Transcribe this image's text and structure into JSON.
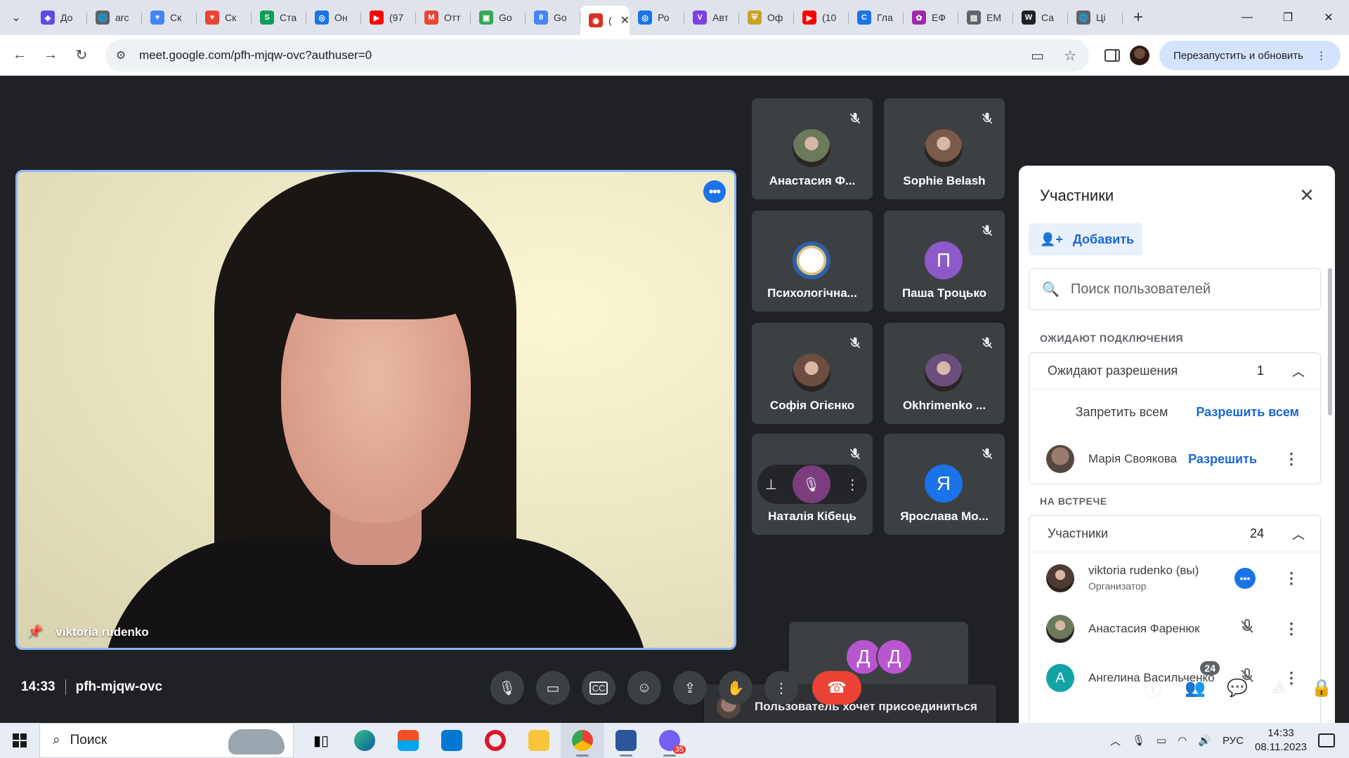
{
  "browser": {
    "tabs": [
      {
        "title": "До",
        "color": "#5b4de3",
        "glyph": "◈"
      },
      {
        "title": "arc",
        "color": "#5f6368",
        "glyph": "🌐"
      },
      {
        "title": "Ск",
        "color": "#4285f4",
        "glyph": "♥"
      },
      {
        "title": "Ск",
        "color": "#ea4335",
        "glyph": "♥"
      },
      {
        "title": "Ста",
        "color": "#0f9d58",
        "glyph": "S"
      },
      {
        "title": "Он",
        "color": "#1a73e8",
        "glyph": "◎"
      },
      {
        "title": "(97",
        "color": "#ff0000",
        "glyph": "▶"
      },
      {
        "title": "Отт",
        "color": "#ea4335",
        "glyph": "M"
      },
      {
        "title": "Go",
        "color": "#34a853",
        "glyph": "▣"
      },
      {
        "title": "Go",
        "color": "#4285f4",
        "glyph": "8"
      },
      {
        "title": "(",
        "color": "#d93025",
        "glyph": "◉",
        "active": true
      },
      {
        "title": "Ро",
        "color": "#1a73e8",
        "glyph": "◎"
      },
      {
        "title": "Авт",
        "color": "#7b3fe4",
        "glyph": "V"
      },
      {
        "title": "Оф",
        "color": "#c9a227",
        "glyph": "⛨"
      },
      {
        "title": "(10",
        "color": "#ff0000",
        "glyph": "▶"
      },
      {
        "title": "Гла",
        "color": "#1a73e8",
        "glyph": "C"
      },
      {
        "title": "ЕФ",
        "color": "#9c27b0",
        "glyph": "✿"
      },
      {
        "title": "ЕМ",
        "color": "#5f6368",
        "glyph": "▤"
      },
      {
        "title": "Са",
        "color": "#202124",
        "glyph": "W"
      },
      {
        "title": "Ці",
        "color": "#5f6368",
        "glyph": "🌐"
      }
    ],
    "url": "meet.google.com/pfh-mjqw-ovc?authuser=0",
    "relaunch_label": "Перезапустить и обновить"
  },
  "meet": {
    "main_speaker": "viktoria rudenko",
    "tiles": [
      {
        "name": "Анастасия Ф...",
        "avatar": "photo",
        "color": "#6b7a5a",
        "muted": true
      },
      {
        "name": "Sophie Belash",
        "avatar": "photo",
        "color": "#7a5a48",
        "muted": true
      },
      {
        "name": "Психологічна...",
        "avatar": "logo",
        "color": "#f1f3f4",
        "muted": false
      },
      {
        "name": "Паша Троцько",
        "avatar": "П",
        "color": "#8e59c9",
        "muted": true
      },
      {
        "name": "Софія Огієнко",
        "avatar": "photo",
        "color": "#6d4c41",
        "muted": true
      },
      {
        "name": "Okhrimenko ...",
        "avatar": "photo",
        "color": "#6a4f7c",
        "muted": true
      },
      {
        "name": "Наталія Кібець",
        "avatar": "hover",
        "color": "#7b3d7e",
        "muted": true
      },
      {
        "name": "Ярослава Мо...",
        "avatar": "Я",
        "color": "#1a73e8",
        "muted": true
      }
    ],
    "more_people": [
      "Д",
      "Д"
    ],
    "toast": "Пользователь хочет присоединиться",
    "meeting_time": "14:33",
    "meeting_code": "pfh-mjqw-ovc",
    "participant_count": "24"
  },
  "panel": {
    "title": "Участники",
    "add_label": "Добавить",
    "search_placeholder": "Поиск пользователей",
    "waiting_caption": "ОЖИДАЮТ ПОДКЛЮЧЕНИЯ",
    "waiting_header": "Ожидают разрешения",
    "waiting_count": "1",
    "deny_all": "Запретить всем",
    "allow_all": "Разрешить всем",
    "waiting_person": "Марія Своякова",
    "allow_label": "Разрешить",
    "in_meeting_caption": "НА ВСТРЕЧЕ",
    "participants_header": "Участники",
    "participants_count": "24",
    "participants": [
      {
        "name": "viktoria rudenko (вы)",
        "role": "Организатор",
        "avatar": "photo",
        "color": "#4e3b33"
      },
      {
        "name": "Анастасия Фаренюк",
        "role": "",
        "avatar": "photo",
        "color": "#6b7a5a"
      },
      {
        "name": "Ангелина Васильченко",
        "role": "",
        "avatar": "А",
        "color": "#12a4a4"
      }
    ]
  },
  "taskbar": {
    "search_label": "Поиск",
    "lang": "РУС",
    "time": "14:33",
    "date": "08.11.2023",
    "viber_badge": "35"
  }
}
